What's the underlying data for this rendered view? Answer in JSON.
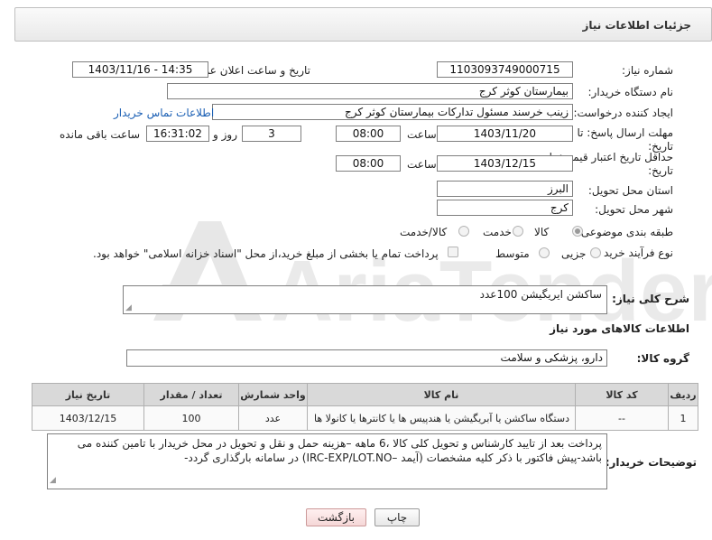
{
  "header": {
    "title": "جزئیات اطلاعات نیاز"
  },
  "form": {
    "need_number_label": "شماره نیاز:",
    "need_number": "1103093749000715",
    "announce_label": "تاریخ و ساعت اعلان عمومی:",
    "announce_value": "1403/11/16 - 14:35",
    "buyer_org_label": "نام دستگاه خریدار:",
    "buyer_org": "بیمارستان کوثر کرج",
    "creator_label": "ایجاد کننده درخواست:",
    "creator": "زینب خرسند مسئول تدارکات بیمارستان کوثر کرج",
    "contact_link": "اطلاعات تماس خریدار",
    "deadline_label_1": "مهلت ارسال پاسخ: تا",
    "deadline_label_2": "تاریخ:",
    "deadline_date": "1403/11/20",
    "time_label": "ساعت",
    "deadline_time": "08:00",
    "days_value": "3",
    "days_label": "روز و",
    "remaining_time": "16:31:02",
    "remaining_label": "ساعت باقی مانده",
    "validity_label_1": "حداقل تاریخ اعتبار قیمت: تا",
    "validity_label_2": "تاریخ:",
    "validity_date": "1403/12/15",
    "validity_time": "08:00",
    "province_label": "استان محل تحویل:",
    "province": "البرز",
    "city_label": "شهر محل تحویل:",
    "city": "کرج",
    "category_label": "طبقه بندی موضوعی:",
    "category_options": [
      "کالا",
      "خدمت",
      "کالا/خدمت"
    ],
    "category_selected": "کالا",
    "process_label": "نوع فرآیند خرید :",
    "process_options": [
      "جزیی",
      "متوسط"
    ],
    "payment_note": "پرداخت تمام یا بخشی از مبلغ خرید،از محل \"اسناد خزانه اسلامی\" خواهد بود.",
    "description_label": "شرح کلی نیاز:",
    "description": "ساکشن ایریگیشن 100عدد",
    "goods_info_title": "اطلاعات کالاهای مورد نیاز",
    "goods_group_label": "گروه کالا:",
    "goods_group": "دارو، پزشکی و سلامت",
    "buyer_notes_label": "توضیحات خریدار:",
    "buyer_notes": "پرداخت بعد از تایید کارشناس و تحویل کلی کالا ،6 ماهه –هزینه حمل و نقل و تحویل در محل خریدار با تامین کننده می باشد-پیش فاکتور با ذکر کلیه مشخصات (آیمد –IRC-EXP/LOT.NO) در سامانه بارگذاری گردد-"
  },
  "table": {
    "headers": [
      "ردیف",
      "کد کالا",
      "نام کالا",
      "واحد شمارش",
      "تعداد / مقدار",
      "تاریخ نیاز"
    ],
    "rows": [
      [
        "1",
        "--",
        "دستگاه ساکشن یا آبریگیشن یا هندپیس ها یا کانترها یا کانولا ها",
        "عدد",
        "100",
        "1403/12/15"
      ]
    ]
  },
  "buttons": {
    "print": "چاپ",
    "back": "بازگشت"
  },
  "watermark": {
    "text": "AriaTender.neT"
  }
}
